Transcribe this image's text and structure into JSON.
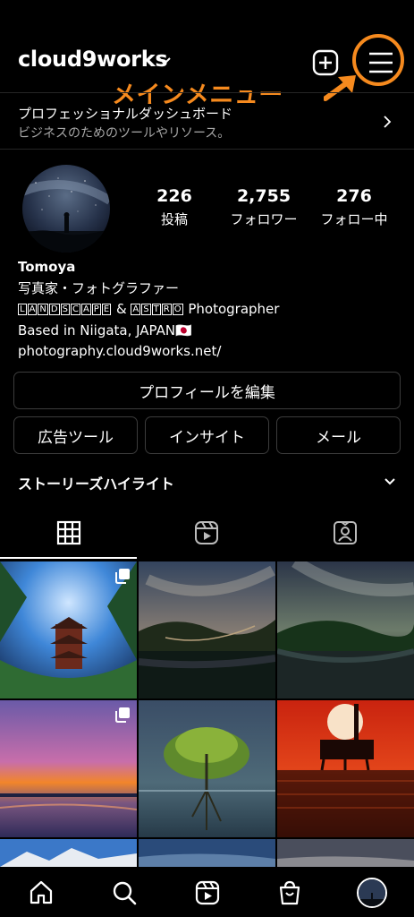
{
  "header": {
    "username": "cloud9works",
    "annotation": "メインメニュー"
  },
  "dashboard": {
    "title": "プロフェッショナルダッシュボード",
    "subtitle": "ビジネスのためのツールやリソース。"
  },
  "stats": [
    {
      "value": "226",
      "label": "投稿"
    },
    {
      "value": "2,755",
      "label": "フォロワー"
    },
    {
      "value": "276",
      "label": "フォロー中"
    }
  ],
  "bio": {
    "name": "Tomoya",
    "line1": "写真家・フォトグラファー",
    "boxed_word_1": [
      "L",
      "A",
      "N",
      "D",
      "S",
      "C",
      "A",
      "P",
      "E"
    ],
    "amp": "&",
    "boxed_word_2": [
      "A",
      "S",
      "T",
      "R",
      "O"
    ],
    "line2_suffix": "Photographer",
    "line3": "Based in Niigata, JAPAN",
    "flag": "🇯🇵",
    "website": "photography.cloud9works.net/"
  },
  "buttons": {
    "edit_profile": "プロフィールを編集",
    "ad_tools": "広告ツール",
    "insights": "インサイト",
    "email": "メール"
  },
  "stories_highlights": "ストーリーズハイライト",
  "tabs": [
    "grid-icon",
    "reels-icon",
    "tagged-icon"
  ],
  "bottom_nav": [
    "home-icon",
    "search-icon",
    "reels-icon",
    "shop-icon",
    "profile-avatar"
  ],
  "colors": {
    "annotation": "#f68a1e",
    "background": "#000000",
    "border": "#3c3c3c"
  }
}
